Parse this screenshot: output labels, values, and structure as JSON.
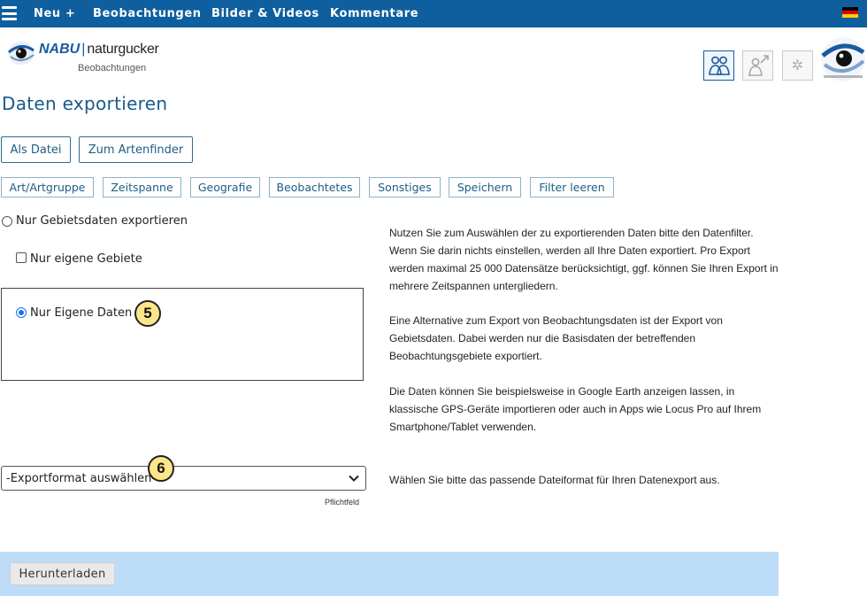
{
  "nav": {
    "items": [
      {
        "label": "Neu +"
      },
      {
        "label": "Beobachtungen"
      },
      {
        "label": "Bilder & Videos"
      },
      {
        "label": "Kommentare"
      }
    ],
    "flag_colors": [
      "#000000",
      "#dd0000",
      "#ffce00"
    ]
  },
  "brand": {
    "nabu": "NABU",
    "naturgucker": "naturgucker",
    "subtitle": "Beobachtungen"
  },
  "header_icons": [
    "users-icon",
    "share-user-icon",
    "gear-icon"
  ],
  "page": {
    "title": "Daten exportieren"
  },
  "mode_buttons": {
    "file": "Als Datei",
    "artenfinder": "Zum Artenfinder"
  },
  "filters": [
    {
      "label": "Art/Artgruppe"
    },
    {
      "label": "Zeitspanne"
    },
    {
      "label": "Geografie"
    },
    {
      "label": "Beobachtetes"
    },
    {
      "label": "Sonstiges"
    },
    {
      "label": "Speichern"
    },
    {
      "label": "Filter leeren"
    }
  ],
  "options": {
    "area_only": {
      "label": "Nur Gebietsdaten exportieren",
      "checked": false
    },
    "own_areas": {
      "label": "Nur eigene Gebiete",
      "checked": false
    },
    "own_data": {
      "label": "Nur Eigene Daten",
      "checked": true
    }
  },
  "markers": {
    "m5": "5",
    "m6": "6"
  },
  "info": {
    "p1": "Nutzen Sie zum Auswählen der zu exportierenden Daten bitte den Datenfilter. Wenn Sie darin nichts einstellen, werden all Ihre Daten exportiert. Pro Export werden maximal 25 000 Datensätze berücksichtigt, ggf. können Sie Ihren Export in mehrere Zeitspannen untergliedern.",
    "p2": "Eine Alternative zum Export von Beobachtungsdaten ist der Export von Gebietsdaten. Dabei werden nur die Basisdaten der betreffenden Beobachtungsgebiete exportiert.",
    "p3": "Die Daten können Sie beispielsweise in Google Earth anzeigen lassen, in klassische GPS-Geräte importieren oder auch in Apps wie Locus Pro auf Ihrem Smartphone/Tablet verwenden.",
    "format_hint": "Wählen Sie bitte das passende Dateiformat für Ihren Datenexport aus."
  },
  "format_select": {
    "value": "-Exportformat auswählen-",
    "required_label": "Pflichtfeld"
  },
  "download": {
    "label": "Herunterladen"
  },
  "colors": {
    "nav_bg": "#0f5f9e",
    "accent": "#1a5a8a",
    "footer_bg": "#bddcf7",
    "marker_bg": "#fde68a"
  }
}
